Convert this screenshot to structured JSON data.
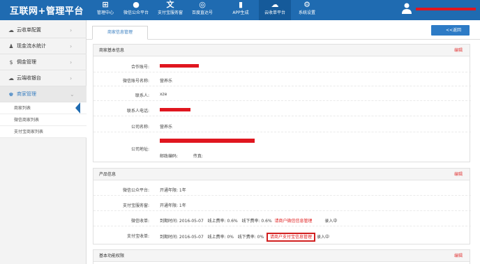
{
  "header": {
    "brand": "互联网+管理平台",
    "nav": [
      {
        "icon": "⊞",
        "label": "管理中心"
      },
      {
        "icon": "●",
        "label": "微信公众平台"
      },
      {
        "icon": "文",
        "label": "支付宝服务窗"
      },
      {
        "icon": "◎",
        "label": "百度直达号"
      },
      {
        "icon": "▮",
        "label": "APP生成"
      },
      {
        "icon": "☁",
        "label": "云收单平台"
      },
      {
        "icon": "⚙",
        "label": "系统设置"
      }
    ],
    "active_nav": "云收单平台"
  },
  "sidebar": {
    "items": [
      {
        "icon": "cloud-settings-icon",
        "glyph": "☁",
        "label": "云收单配置",
        "chevron": "›"
      },
      {
        "icon": "person-icon",
        "glyph": "♟",
        "label": "现金流水统计",
        "chevron": "›"
      },
      {
        "icon": "coin-icon",
        "glyph": "$",
        "label": "佣金管理",
        "chevron": "›"
      },
      {
        "icon": "cloud-icon",
        "glyph": "☁",
        "label": "云端收银台",
        "chevron": "›"
      },
      {
        "icon": "users-icon",
        "glyph": "♚",
        "label": "商家管理",
        "chevron": "⌄"
      }
    ],
    "sub_items": [
      "商家列表",
      "微信商家列表",
      "支付宝商家列表"
    ]
  },
  "tab": {
    "label": "商家信息管理"
  },
  "back_button": {
    "label": "<<返回"
  },
  "merchant_panel": {
    "title": "商家基本信息",
    "edit": "编辑",
    "fields": {
      "account_label": "合作账号:",
      "wechat_name_label": "微信账号名称:",
      "wechat_name_value": "营养乐",
      "contact_label": "联系人:",
      "contact_value": "xze",
      "phone_label": "联系人电话:",
      "company_label": "公司名称:",
      "company_value": "营养乐",
      "address_label": "公司地址:",
      "postcode_label": "邮政编码:",
      "fax_label": "传真:"
    }
  },
  "product_panel": {
    "title": "产品信息",
    "edit": "编辑",
    "wechat_platform_label": "微信公众平台:",
    "wechat_platform_value": "开通年限: 1年",
    "alipay_window_label": "支付宝服务窗:",
    "alipay_window_value": "开通年限: 1年",
    "wechat_pay_label": "微信收单:",
    "wechat_pay_expiry": "到期时间: 2016-05-07",
    "wechat_pay_online": "线上费率: 0.6%",
    "wechat_pay_offline": "线下费率: 0.6%",
    "wechat_pay_link": "请商户微信信息管理",
    "wechat_pay_status": "录入中",
    "alipay_pay_label": "支付宝收单:",
    "alipay_pay_expiry": "到期时间: 2016-05-07",
    "alipay_pay_online": "线上费率: 0%",
    "alipay_pay_offline": "线下费率: 0%",
    "alipay_pay_link": "请商户支付宝信息管理",
    "alipay_pay_status": "录入中"
  },
  "features_panel": {
    "title": "基本功能权限",
    "edit": "编辑"
  },
  "colors": {
    "topbar": "#1f6bb1",
    "accent": "#2d7bc6",
    "edit_red": "#e23b3b",
    "redaction": "#e0161f"
  }
}
